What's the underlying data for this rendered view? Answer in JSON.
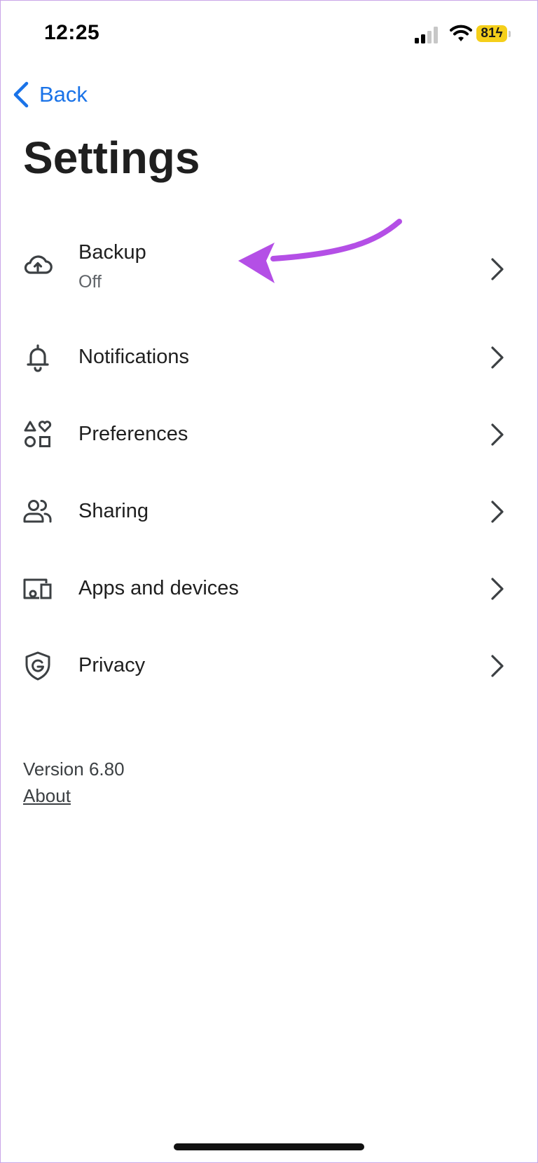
{
  "status_bar": {
    "time": "12:25",
    "battery": "81"
  },
  "nav": {
    "back_label": "Back"
  },
  "page": {
    "title": "Settings"
  },
  "settings": {
    "items": [
      {
        "label": "Backup",
        "sublabel": "Off",
        "icon": "cloud-upload-icon"
      },
      {
        "label": "Notifications",
        "icon": "bell-icon"
      },
      {
        "label": "Preferences",
        "icon": "shapes-icon"
      },
      {
        "label": "Sharing",
        "icon": "people-icon"
      },
      {
        "label": "Apps and devices",
        "icon": "devices-icon"
      },
      {
        "label": "Privacy",
        "icon": "google-shield-icon"
      }
    ]
  },
  "footer": {
    "version": "Version 6.80",
    "about": "About"
  },
  "colors": {
    "accent": "#1a73e8",
    "annotation": "#b44fe6",
    "battery": "#f5cf1a"
  }
}
